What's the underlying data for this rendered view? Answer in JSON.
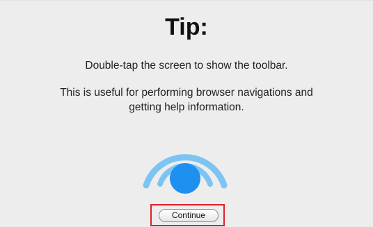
{
  "dialog": {
    "title": "Tip:",
    "message_primary": "Double-tap the screen to show the toolbar.",
    "message_secondary_line1": "This is useful for performing browser navigations and",
    "message_secondary_line2": "getting help information.",
    "icon": "double-tap-icon",
    "continue_label": "Continue"
  },
  "colors": {
    "background": "#ededed",
    "tap_dot": "#1e90f0",
    "tap_waves": "#7ec4f2",
    "highlight_outline": "#e0202a"
  }
}
